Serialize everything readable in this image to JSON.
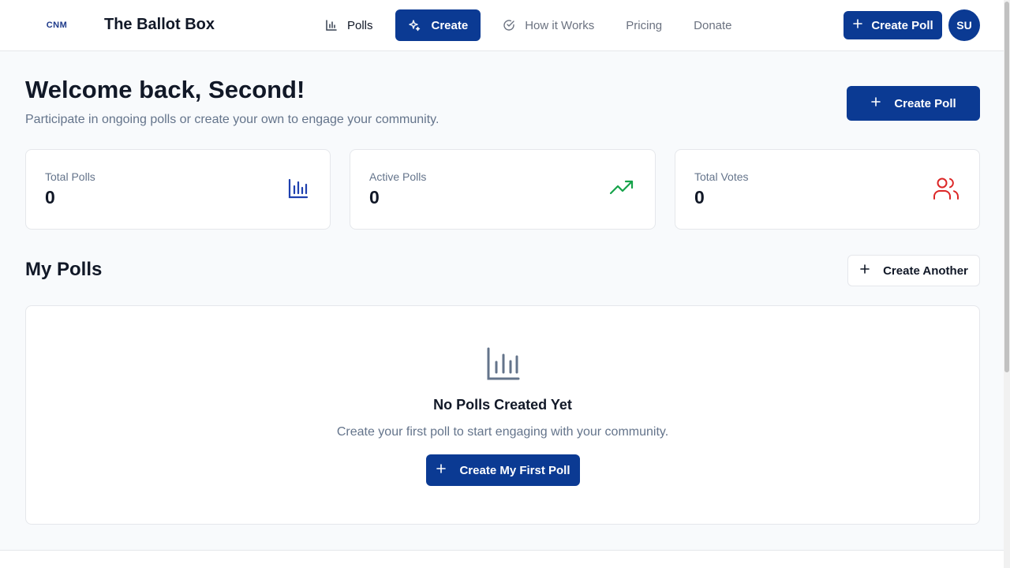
{
  "header": {
    "logo_text": "CNM",
    "brand": "The Ballot Box",
    "nav": [
      {
        "label": "Polls",
        "icon": "bar-chart-icon"
      },
      {
        "label": "Create",
        "icon": "sparkles-icon",
        "active": true
      },
      {
        "label": "How it Works",
        "icon": "check-circle-icon"
      },
      {
        "label": "Pricing"
      },
      {
        "label": "Donate"
      }
    ],
    "create_poll_label": "Create Poll",
    "avatar_initials": "SU"
  },
  "welcome": {
    "title": "Welcome back, Second!",
    "subtitle": "Participate in ongoing polls or create your own to engage your community.",
    "create_label": "Create Poll"
  },
  "stats": [
    {
      "label": "Total Polls",
      "value": "0",
      "icon": "bar-chart-icon",
      "color": "#1e40af"
    },
    {
      "label": "Active Polls",
      "value": "0",
      "icon": "trending-up-icon",
      "color": "#16a34a"
    },
    {
      "label": "Total Votes",
      "value": "0",
      "icon": "users-icon",
      "color": "#dc2626"
    }
  ],
  "my_polls": {
    "title": "My Polls",
    "create_another_label": "Create Another",
    "empty_title": "No Polls Created Yet",
    "empty_description": "Create your first poll to start engaging with your community.",
    "first_poll_label": "Create My First Poll"
  },
  "colors": {
    "primary": "#0b3a93",
    "background": "#f8fafc",
    "muted_text": "#64748b"
  }
}
